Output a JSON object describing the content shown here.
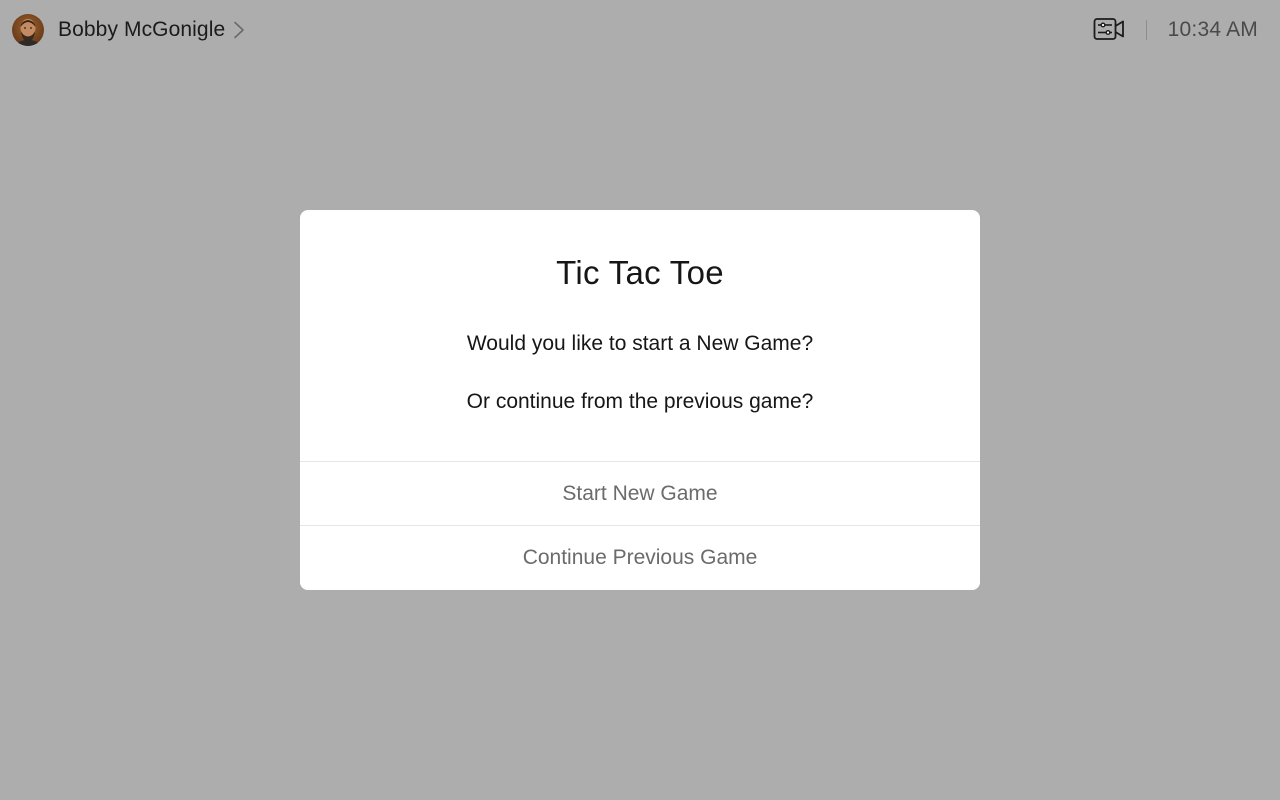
{
  "header": {
    "user_name": "Bobby McGonigle",
    "time": "10:34 AM",
    "icons": {
      "avatar": "user-avatar",
      "chevron": "chevron-right-icon",
      "camera_settings": "camera-settings-icon"
    }
  },
  "dialog": {
    "title": "Tic Tac Toe",
    "message_line_1": "Would you like to start a New Game?",
    "message_line_2": "Or continue from the previous game?",
    "actions": [
      {
        "label": "Start New Game"
      },
      {
        "label": "Continue Previous Game"
      }
    ]
  },
  "colors": {
    "backdrop": "#adadad",
    "dialog_background": "#ffffff",
    "action_text": "#6b6b6b",
    "separator": "#e6e6e6"
  }
}
